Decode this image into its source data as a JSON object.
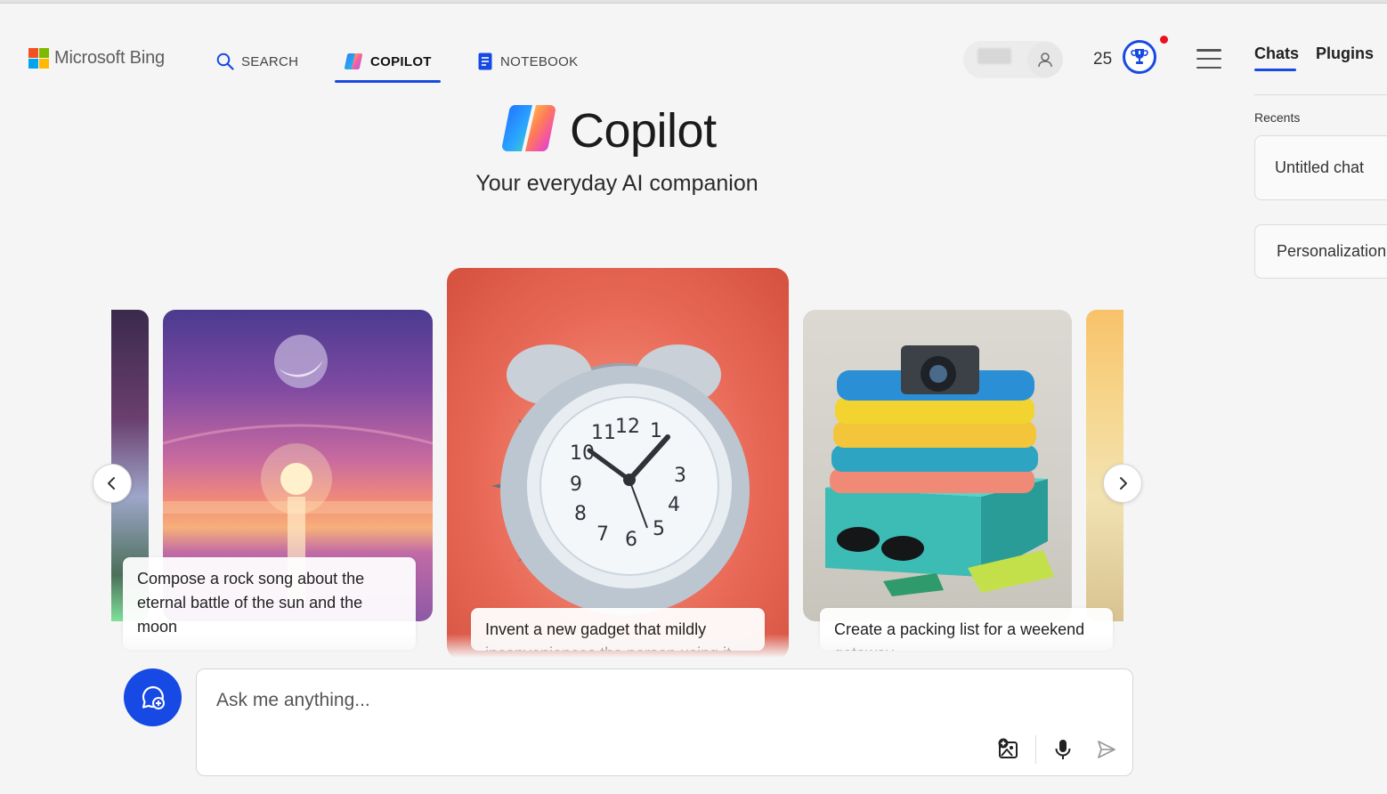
{
  "header": {
    "brand": "Microsoft Bing",
    "nav": [
      {
        "label": "SEARCH",
        "icon": "search-icon"
      },
      {
        "label": "COPILOT",
        "icon": "copilot-icon",
        "active": true
      },
      {
        "label": "NOTEBOOK",
        "icon": "notebook-icon"
      }
    ],
    "rewards_points": "25"
  },
  "side_panel": {
    "tabs": [
      "Chats",
      "Plugins"
    ],
    "active_tab": "Chats",
    "recents_label": "Recents",
    "recents": [
      "Untitled chat"
    ],
    "personalization": "Personalization"
  },
  "hero": {
    "title": "Copilot",
    "subtitle": "Your everyday AI companion"
  },
  "carousel": {
    "cards": [
      {
        "caption": "Compose a rock song about the eternal battle of the sun and the moon"
      },
      {
        "caption": "Invent a new gadget that mildly inconveniences the person using it"
      },
      {
        "caption": "Create a packing list for a weekend getaway"
      }
    ]
  },
  "composer": {
    "placeholder": "Ask me anything..."
  },
  "colors": {
    "accent": "#174ae4",
    "notification": "#e81123",
    "background": "#f5f5f5"
  }
}
